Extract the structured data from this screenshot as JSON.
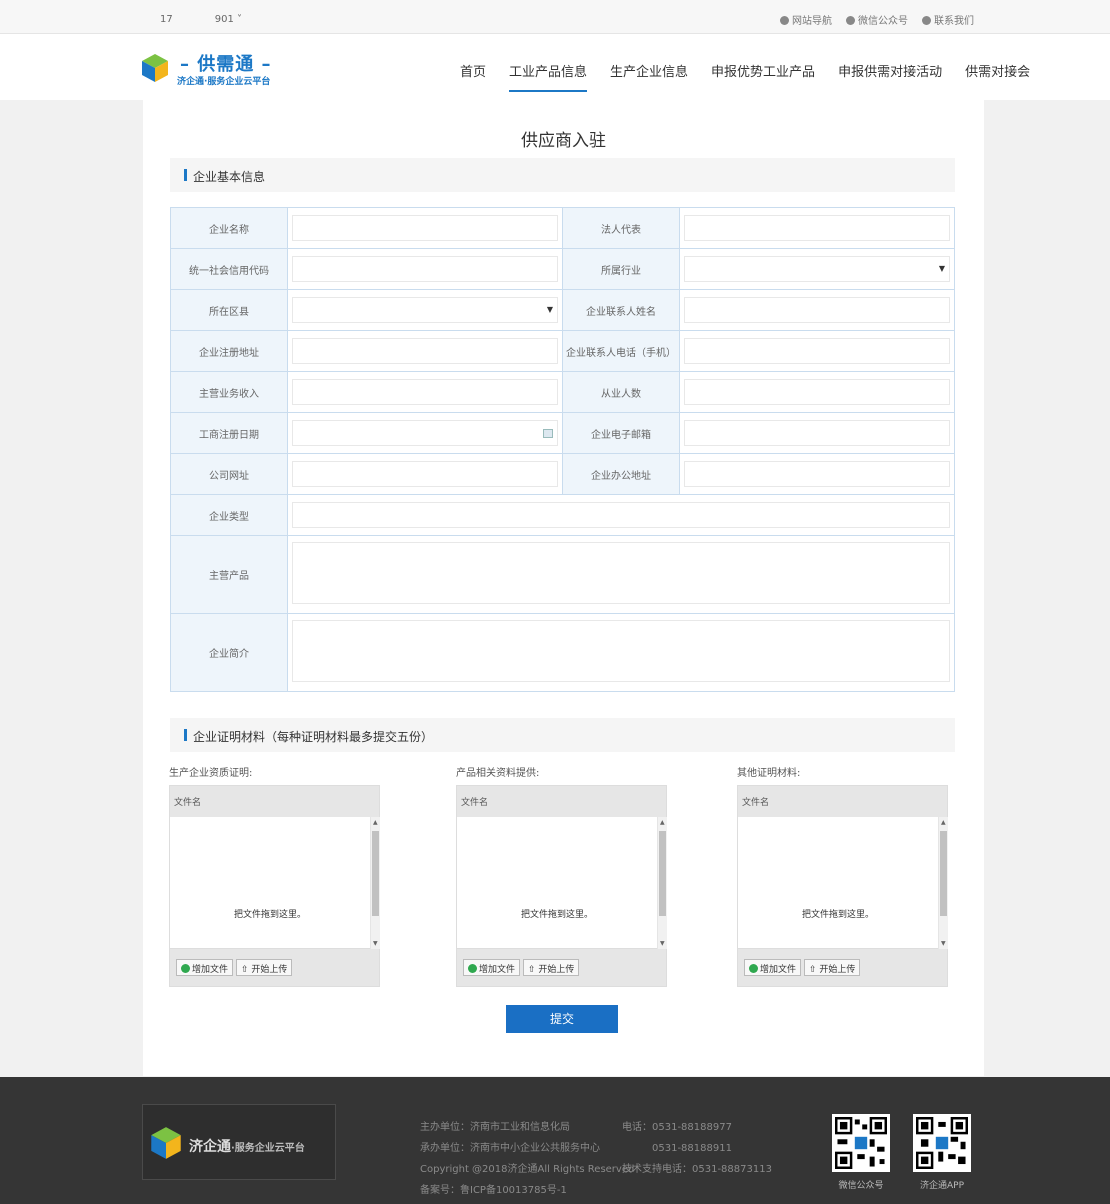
{
  "topbar": {
    "user_prefix": "17",
    "user_suffix": "901",
    "links": [
      "网站导航",
      "微信公众号",
      "联系我们"
    ]
  },
  "logo": {
    "title": "– 供需通 –",
    "subtitle": "济企通·服务企业云平台"
  },
  "nav": [
    "首页",
    "工业产品信息",
    "生产企业信息",
    "申报优势工业产品",
    "申报供需对接活动",
    "供需对接会"
  ],
  "page": {
    "title": "供应商入驻"
  },
  "section1": {
    "title": "企业基本信息"
  },
  "form": {
    "company_name": "企业名称",
    "legal_rep": "法人代表",
    "credit_code": "统一社会信用代码",
    "industry": "所属行业",
    "district": "所在区县",
    "contact_name": "企业联系人姓名",
    "reg_address": "企业注册地址",
    "contact_phone": "企业联系人电话（手机）",
    "revenue": "主营业务收入",
    "employees": "从业人数",
    "reg_date": "工商注册日期",
    "email": "企业电子邮箱",
    "website": "公司网址",
    "office_address": "企业办公地址",
    "company_type": "企业类型",
    "main_products": "主营产品",
    "intro": "企业简介"
  },
  "section2": {
    "title": "企业证明材料（每种证明材料最多提交五份）"
  },
  "uploads": [
    {
      "caption": "生产企业资质证明:",
      "file_header": "文件名",
      "drop_hint": "把文件拖到这里。",
      "add_label": "增加文件",
      "upload_label": "开始上传"
    },
    {
      "caption": "产品相关资料提供:",
      "file_header": "文件名",
      "drop_hint": "把文件拖到这里。",
      "add_label": "增加文件",
      "upload_label": "开始上传"
    },
    {
      "caption": "其他证明材料:",
      "file_header": "文件名",
      "drop_hint": "把文件拖到这里。",
      "add_label": "增加文件",
      "upload_label": "开始上传"
    }
  ],
  "submit_label": "提交",
  "footer": {
    "logo_main": "济企通",
    "logo_sub": "·服务企业云平台",
    "lines_left": [
      "主办单位：济南市工业和信息化局",
      "承办单位：济南市中小企业公共服务中心",
      "Copyright @2018济企通All Rights Reserved",
      "备案号：鲁ICP备10013785号-1"
    ],
    "lines_right": [
      "电话：0531-88188977",
      "　　　0531-88188911",
      "技术支持电话：0531-88873113"
    ],
    "qr_captions": [
      "微信公众号",
      "济企通APP"
    ]
  },
  "colors": {
    "brand": "#1c78c6",
    "submit": "#1a6fc4",
    "footer_bg": "#353535"
  }
}
